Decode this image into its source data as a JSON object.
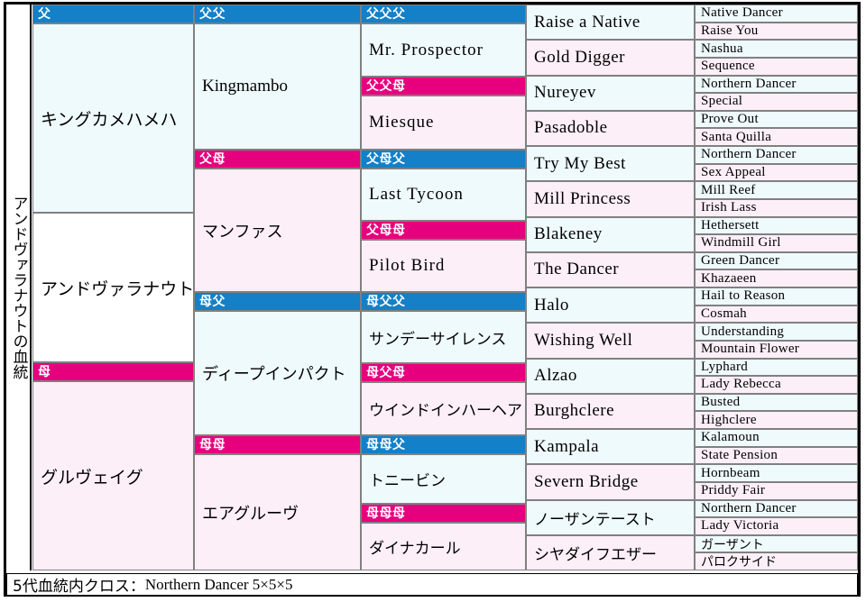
{
  "title_vertical": "アンドヴァラナウトの血統",
  "colors": {
    "sire_header": "#1380c8",
    "dam_header": "#e6007e",
    "sire_body": "#effafd",
    "dam_body": "#fdeff7",
    "border": "#808080",
    "frame": "#000000"
  },
  "headers": {
    "f": "父",
    "ff": "父父",
    "fff": "父父父",
    "ffm": "父父母",
    "fm": "父母",
    "fmf": "父母父",
    "fmm": "父母母",
    "m": "母",
    "mf": "母父",
    "mff": "母父父",
    "mfm": "母父母",
    "mm": "母母",
    "mmf": "母母父",
    "mmm": "母母母"
  },
  "gen1": {
    "sire": "キングカメハメハ",
    "dam_side_sire": "アンドヴァラナウト",
    "dam": "グルヴェイグ"
  },
  "gen2": {
    "ff": "Kingmambo",
    "fm": "マンファス",
    "mf": "ディープインパクト",
    "mm": "エアグルーヴ"
  },
  "gen3": {
    "fff": "Mr. Prospector",
    "ffm": "Miesque",
    "fmf": "Last Tycoon",
    "fmm": "Pilot Bird",
    "mff": "サンデーサイレンス",
    "mfm": "ウインドインハーヘア",
    "mmf": "トニービン",
    "mmm": "ダイナカール"
  },
  "gen4": [
    "Raise a Native",
    "Gold Digger",
    "Nureyev",
    "Pasadoble",
    "Try My Best",
    "Mill Princess",
    "Blakeney",
    "The Dancer",
    "Halo",
    "Wishing Well",
    "Alzao",
    "Burghclere",
    "Kampala",
    "Severn Bridge",
    "ノーザンテースト",
    "シヤダイフエザー"
  ],
  "gen5": [
    "Native Dancer",
    "Raise You",
    "Nashua",
    "Sequence",
    "Northern Dancer",
    "Special",
    "Prove Out",
    "Santa Quilla",
    "Northern Dancer",
    "Sex Appeal",
    "Mill Reef",
    "Irish Lass",
    "Hethersett",
    "Windmill Girl",
    "Green Dancer",
    "Khazaeen",
    "Hail to Reason",
    "Cosmah",
    "Understanding",
    "Mountain Flower",
    "Lyphard",
    "Lady Rebecca",
    "Busted",
    "Highclere",
    "Kalamoun",
    "State Pension",
    "Hornbeam",
    "Priddy Fair",
    "Northern Dancer",
    "Lady Victoria",
    "ガーザント",
    "パロクサイド"
  ],
  "footer": {
    "label": "5代血統内クロス：",
    "value": "Northern Dancer 5×5×5"
  }
}
